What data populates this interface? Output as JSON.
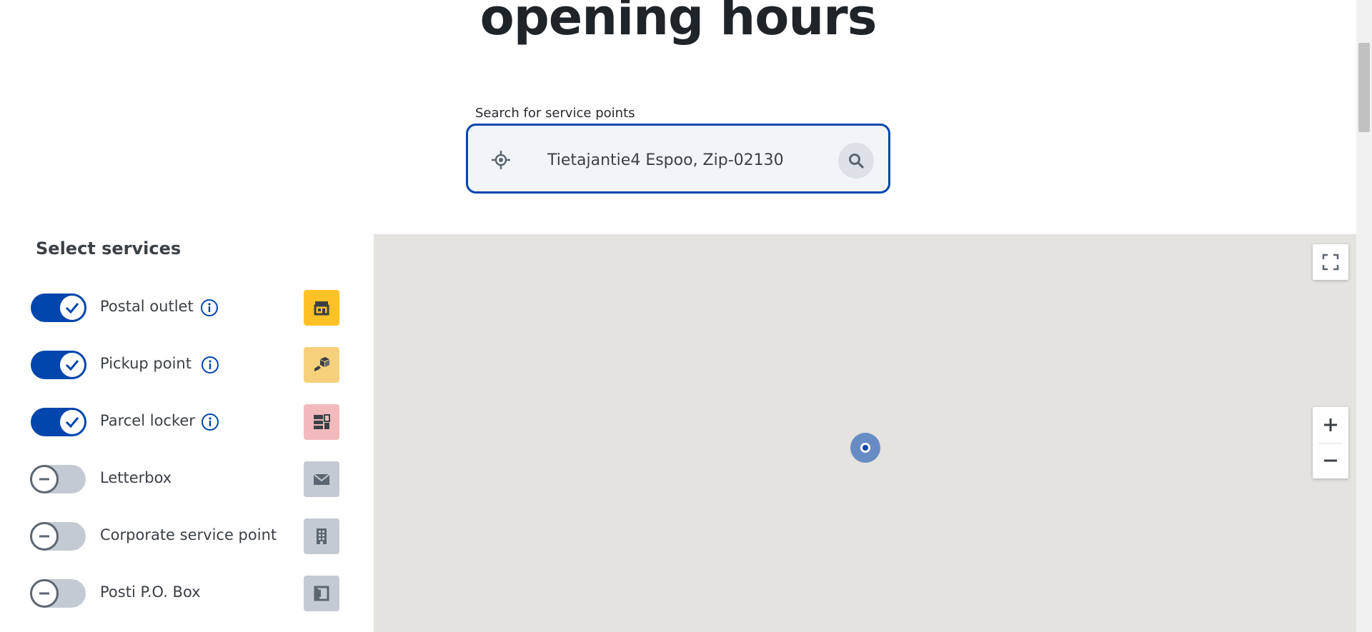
{
  "page": {
    "heading": "opening hours"
  },
  "search": {
    "label": "Search for service points",
    "value": "Tietajantie4 Espoo, Zip-02130",
    "locate_icon": "crosshair-icon",
    "search_icon": "magnifier-icon"
  },
  "services": {
    "title": "Select services",
    "items": [
      {
        "label": "Postal outlet",
        "enabled": true,
        "has_info": true,
        "icon": "storefront-icon",
        "icon_bg": "#ffc226"
      },
      {
        "label": "Pickup point",
        "enabled": true,
        "has_info": true,
        "icon": "parcel-handover-icon",
        "icon_bg": "#f7d07c"
      },
      {
        "label": "Parcel locker",
        "enabled": true,
        "has_info": true,
        "icon": "locker-icon",
        "icon_bg": "#f2babd"
      },
      {
        "label": "Letterbox",
        "enabled": false,
        "has_info": false,
        "icon": "envelope-icon",
        "icon_bg": "#c4cad1"
      },
      {
        "label": "Corporate service point",
        "enabled": false,
        "has_info": false,
        "icon": "building-icon",
        "icon_bg": "#c4cad1"
      },
      {
        "label": "Posti P.O. Box",
        "enabled": false,
        "has_info": false,
        "icon": "po-box-icon",
        "icon_bg": "#c4cad1"
      }
    ]
  },
  "map": {
    "background": "#e4e3e0",
    "controls": {
      "fullscreen_icon": "fullscreen-icon",
      "zoom_in_icon": "plus-icon",
      "zoom_out_icon": "minus-icon"
    }
  },
  "colors": {
    "accent": "#0046ad",
    "text": "#3b4046",
    "toggle_off": "#c4cad1"
  }
}
